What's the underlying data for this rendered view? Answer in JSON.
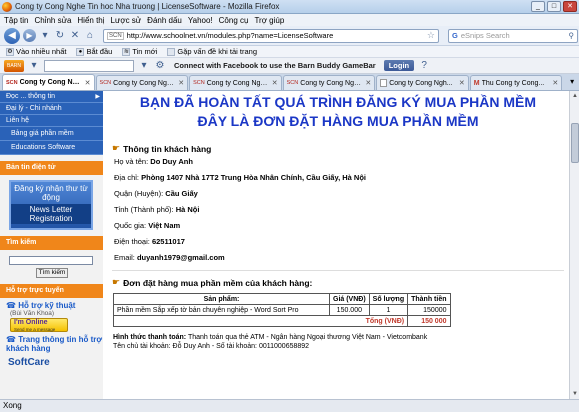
{
  "window": {
    "title": "Cong ty Cong Nghe Tin hoc Nha truong | LicenseSoftware - Mozilla Firefox",
    "controls": [
      "_",
      "□",
      "✕"
    ]
  },
  "menu": [
    "Tập tin",
    "Chỉnh sửa",
    "Hiển thị",
    "Lược sử",
    "Đánh dấu",
    "Yahoo!",
    "Công cụ",
    "Trợ giúp"
  ],
  "nav": {
    "url": "http://www.schoolnet.vn/modules.php?name=LicenseSoftware",
    "url_badge": "SCN",
    "search_placeholder": "eSnips Search",
    "search_engine": "G"
  },
  "bookmarks": [
    {
      "label": "Vào nhiều nhất",
      "icon": "gear-icon"
    },
    {
      "label": "Bắt đầu",
      "icon": "firefox-icon"
    },
    {
      "label": "Tin mới",
      "icon": "rss-icon"
    },
    {
      "label": "Gặp vấn đề khi tải trang",
      "icon": "page-icon"
    }
  ],
  "toolbar2": {
    "logo_text": "BARN",
    "facebook_text": "Connect with Facebook to use the Barn Buddy GameBar",
    "login": "Login"
  },
  "tabs": [
    {
      "label": "Cong ty Cong Ngh...",
      "icon": "SCN",
      "active": true
    },
    {
      "label": "Cong ty Cong Ngh...",
      "icon": "SCN",
      "active": false
    },
    {
      "label": "Cong ty Cong Ngh...",
      "icon": "SCN",
      "active": false
    },
    {
      "label": "Cong ty Cong Ngh...",
      "icon": "SCN",
      "active": false
    },
    {
      "label": "Cong ty Cong Ngh...",
      "icon": "page",
      "active": false
    },
    {
      "label": "Thu Cong ty Cong...",
      "icon": "M",
      "active": false
    }
  ],
  "sidebar": {
    "nav_items": [
      "Đọc ... thông tin",
      "Đại lý - Chi nhánh",
      "Liên hệ"
    ],
    "sub_items": [
      "Bảng giá phần mềm",
      "Educations Software"
    ],
    "news_block": "Bản tin điện tử",
    "banner_line1": "Đăng ký nhận thư từ động",
    "banner_line2": "News Letter Registration",
    "search_block": "Tìm kiếm",
    "search_button": "Tìm kiếm",
    "support_block": "Hỗ trợ trực tuyến",
    "support_link": "Hỗ trợ kỹ thuật",
    "support_person": "(Bùi Văn Khoa)",
    "ym_text": "I'm Online",
    "ym_sub": "Send me a message",
    "info_link": "Trang thông tin hỗ trợ khách hàng",
    "softcare": "SoftCare"
  },
  "main": {
    "heading_line1": "BẠN ĐÃ HOÀN TẤT QUÁ TRÌNH ĐĂNG KÝ MUA PHẦN MỀM",
    "heading_line2": "ĐÂY LÀ ĐƠN ĐẶT HÀNG MUA PHẦN MỀM",
    "customer_title": "Thông tin khách hàng",
    "fields": [
      {
        "label": "Họ và tên:",
        "value": "Do Duy Anh"
      },
      {
        "label": "Địa chỉ:",
        "value": "Phòng 1407 Nhà 17T2 Trung Hòa Nhân Chính, Cầu Giấy, Hà Nội"
      },
      {
        "label": "Quận (Huyện):",
        "value": "Cầu Giấy"
      },
      {
        "label": "Tỉnh (Thành phố):",
        "value": "Hà Nội"
      },
      {
        "label": "Quốc gia:",
        "value": "Việt Nam"
      },
      {
        "label": "Điện thoại:",
        "value": "62511017"
      },
      {
        "label": "Email:",
        "value": "duyanh1979@gmail.com"
      }
    ],
    "order_title": "Đơn đặt hàng mua phần mềm của khách hàng:",
    "table_headers": [
      "Sản phẩm:",
      "Giá (VNĐ)",
      "Số lượng",
      "Thành tiền"
    ],
    "table_rows": [
      [
        "Phần mềm Sắp xếp tờ bản chuyên nghiệp - Word Sort Pro",
        "150.000",
        "1",
        "150000"
      ]
    ],
    "total_label": "Tổng (VNĐ)",
    "total_value": "150 000",
    "payment_label": "Hình thức thanh toán:",
    "payment_value": "Thanh toán qua thẻ ATM - Ngân hàng Ngoại thương Việt Nam - Vietcombank",
    "account_name_label": "Tên chủ tài khoản:",
    "account_name_value": "Đỗ Duy Anh",
    "account_no_label": "Số tài khoản:",
    "account_no_value": "0011000658892"
  },
  "status": "Xong",
  "colors": {
    "heading": "#1b37c6",
    "nav_blue": "#2a62b8",
    "block_orange": "#f0861a",
    "total_red": "#c0392b"
  }
}
